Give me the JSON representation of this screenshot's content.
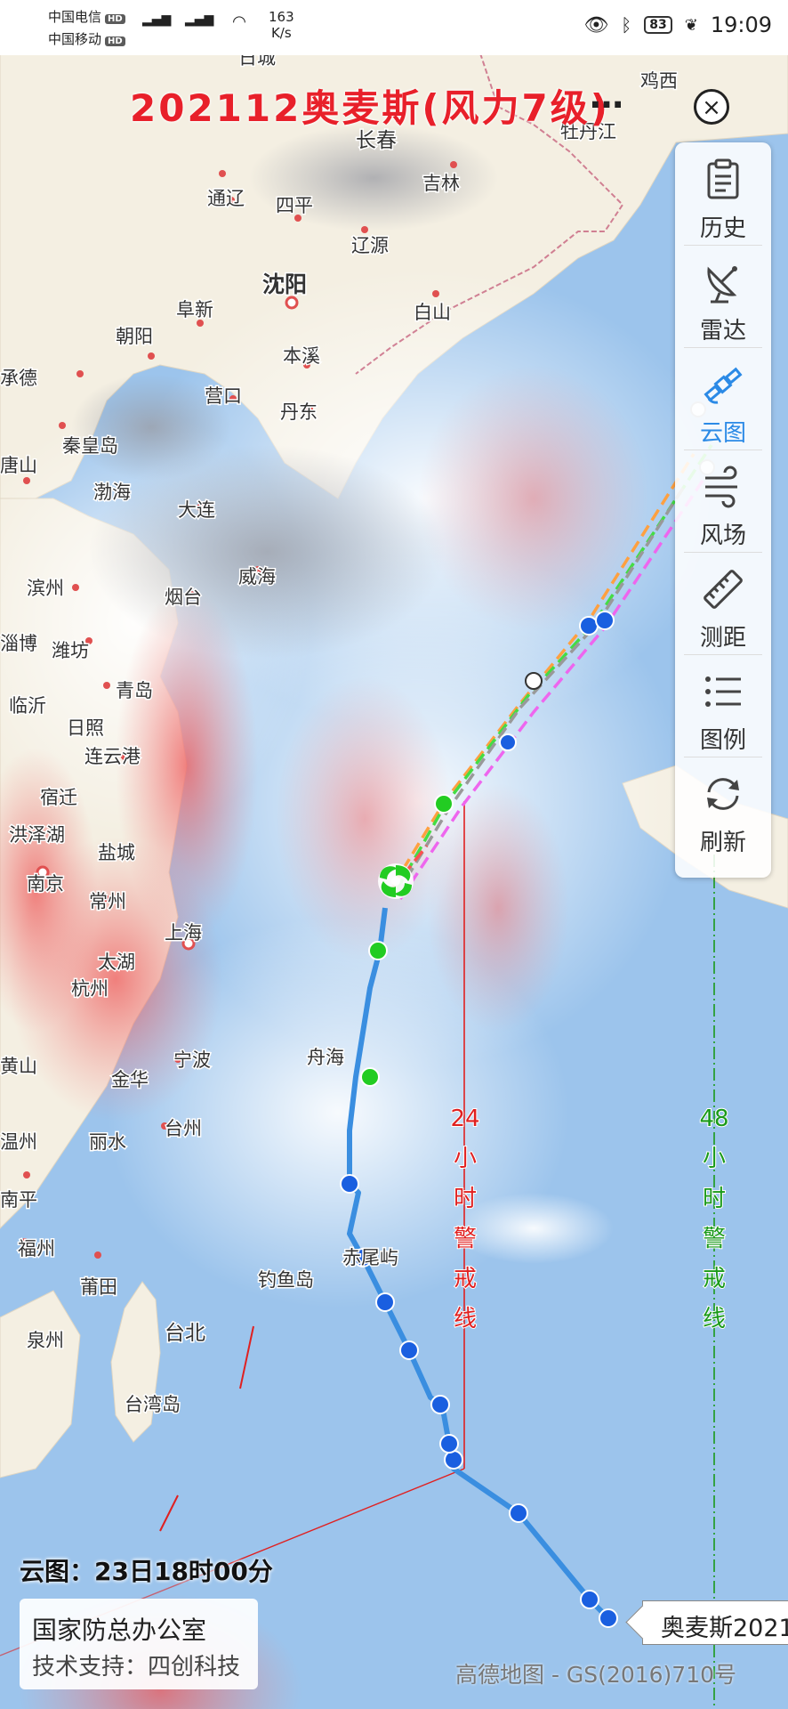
{
  "status_bar": {
    "carrier1": "中国电信",
    "carrier2": "中国移动",
    "hd": "HD",
    "signal1": "4G",
    "signal2": "4G",
    "net_speed": "163",
    "net_unit": "K/s",
    "battery": "83",
    "time": "19:09"
  },
  "header": {
    "title": "202112奥麦斯(风力7级)",
    "more": "…",
    "close_icon": "close-icon"
  },
  "panel": {
    "items": [
      {
        "label": "历史",
        "icon": "clipboard-icon"
      },
      {
        "label": "雷达",
        "icon": "radar-dish-icon"
      },
      {
        "label": "云图",
        "icon": "satellite-icon",
        "selected": true
      },
      {
        "label": "风场",
        "icon": "wind-icon"
      },
      {
        "label": "测距",
        "icon": "ruler-icon"
      },
      {
        "label": "图例",
        "icon": "list-icon"
      },
      {
        "label": "刷新",
        "icon": "refresh-icon"
      }
    ]
  },
  "map": {
    "cities": [
      "日城",
      "鸡西",
      "长春",
      "牡丹江",
      "吉林",
      "通辽",
      "四平",
      "辽源",
      "沈阳",
      "阜新",
      "白山",
      "朝阳",
      "本溪",
      "承德",
      "营口",
      "丹东",
      "秦皇岛",
      "唐山",
      "渤海",
      "大连",
      "滨州",
      "威海",
      "烟台",
      "淄博",
      "潍坊",
      "临沂",
      "青岛",
      "日照",
      "连云港",
      "宿迁",
      "洪泽湖",
      "盐城",
      "南京",
      "常州",
      "上海",
      "太湖",
      "杭州",
      "宁波",
      "金华",
      "黄山",
      "台州",
      "丽水",
      "南平",
      "福州",
      "莆田",
      "泉州",
      "台北",
      "台湾岛",
      "赤尾屿",
      "钓鱼岛",
      "舟海",
      "温州"
    ],
    "warn24": [
      "24",
      "小",
      "时",
      "警",
      "戒",
      "线"
    ],
    "warn48": [
      "48",
      "小",
      "时",
      "警",
      "戒",
      "线"
    ],
    "colors": {
      "track": "#3a8ee0",
      "point_past": "#1a5fe0",
      "point_recent": "#22cc22",
      "warn24": "#e02020",
      "warn48": "#1a9a1a",
      "fc_orange": "#ffa040",
      "fc_green": "#44dd44",
      "fc_magenta": "#ee66ee",
      "fc_gray": "#999999",
      "fc_red": "#ff5050"
    }
  },
  "footer": {
    "cloud_time": "云图：23日18时00分",
    "org_name": "国家防总办公室",
    "tech_support": "技术支持：四创科技",
    "credit": "高德地图 - GS(2016)710号",
    "callout": "奥麦斯2021"
  }
}
